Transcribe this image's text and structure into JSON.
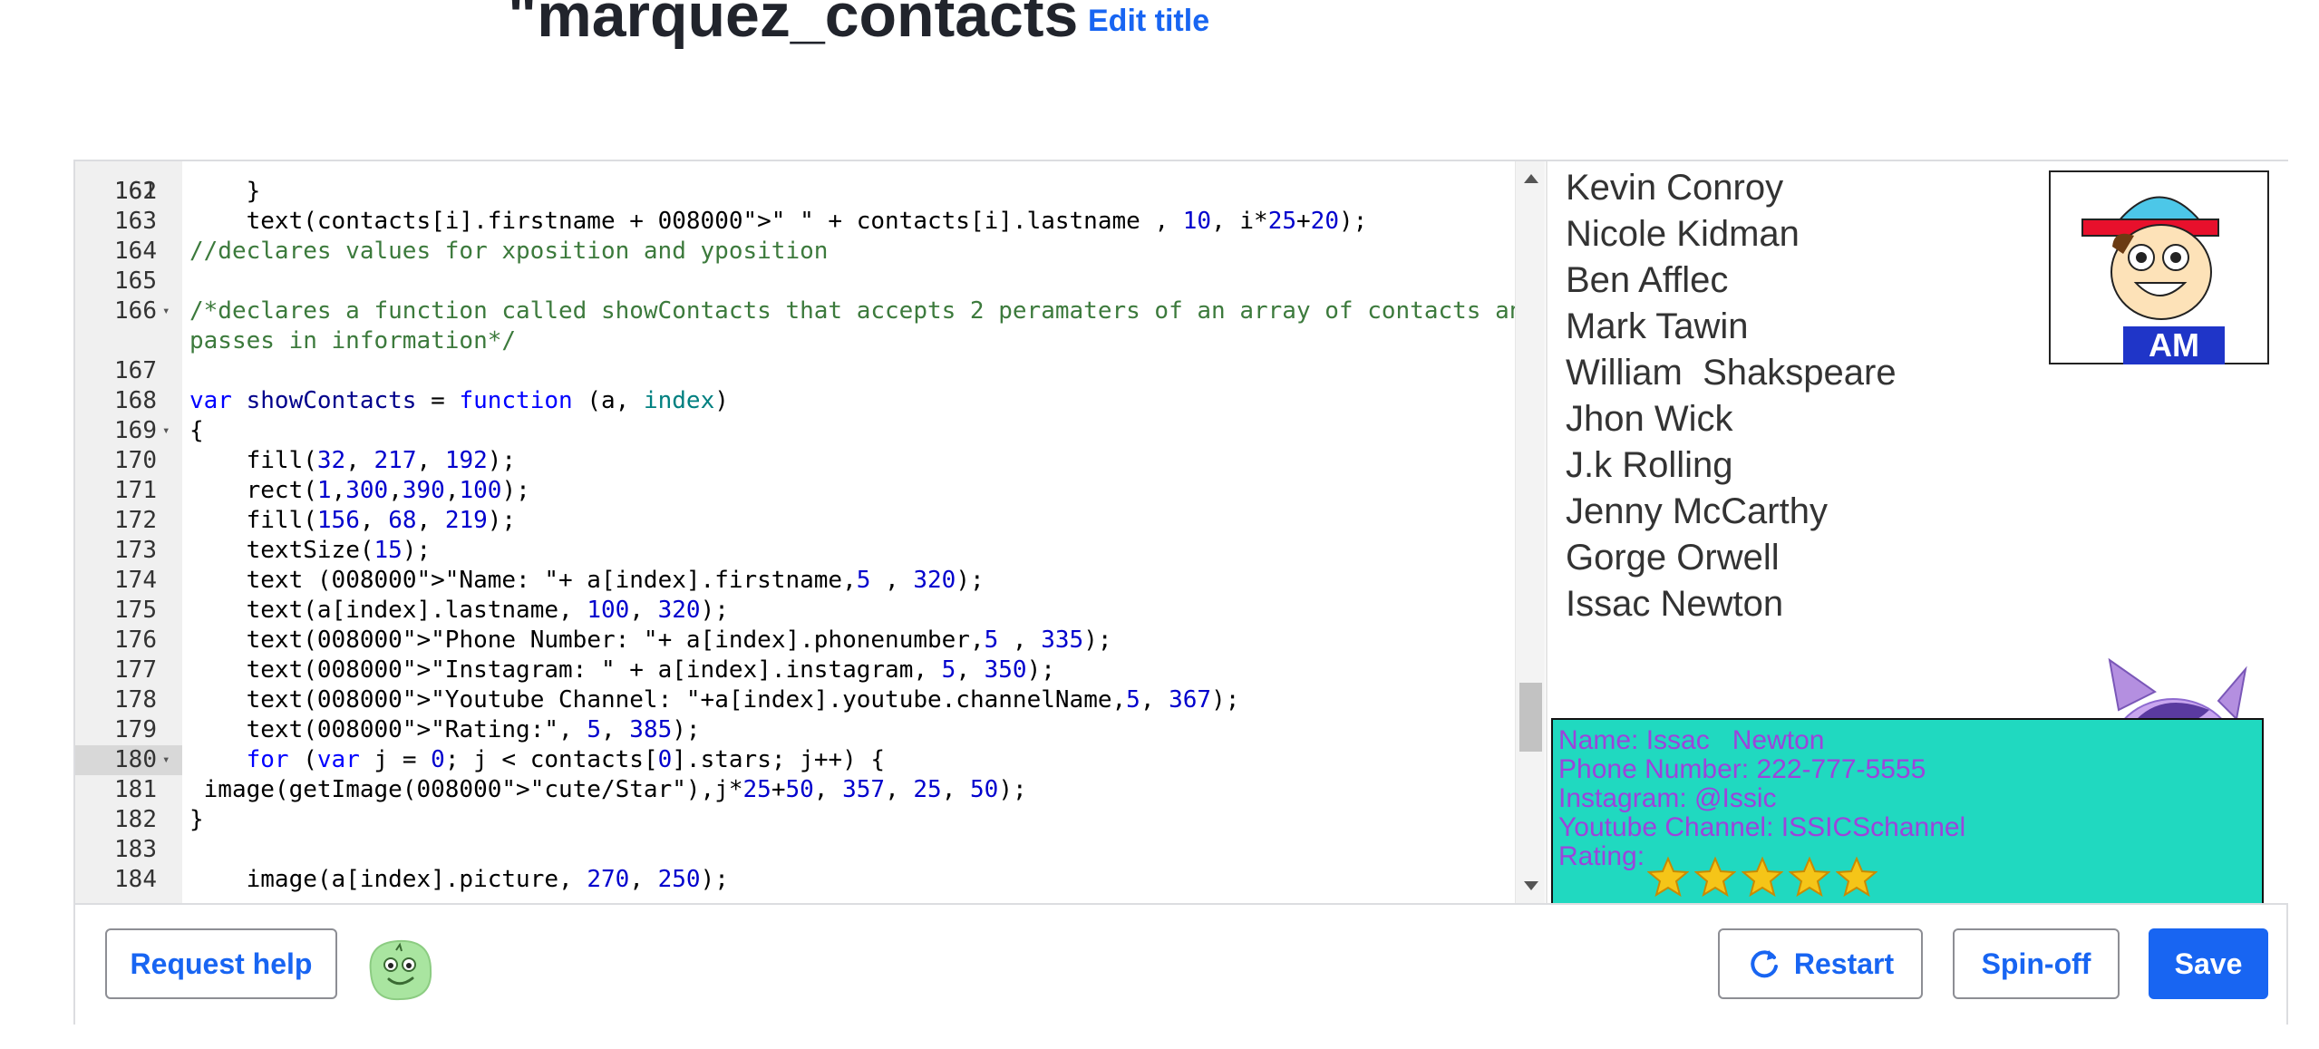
{
  "header": {
    "title": "\"marquez_contacts",
    "edit_title": "Edit title"
  },
  "editor": {
    "partial_top_line": "    text(contacts[i].firstname + \" \" + contacts[i].lastname , 10, i*25+20);",
    "lines": [
      {
        "n": "162",
        "text": "    }"
      },
      {
        "n": "163",
        "text": ""
      },
      {
        "n": "164",
        "text": "//declares values for xposition and yposition"
      },
      {
        "n": "165",
        "text": ""
      },
      {
        "n": "166",
        "text": "/*declares a function called showContacts that accepts 2 peramaters of an array of contacts and passes in information*/",
        "fold": true
      },
      {
        "n": "167",
        "text": ""
      },
      {
        "n": "168",
        "text": "var showContacts = function (a, index)"
      },
      {
        "n": "169",
        "text": "{",
        "fold": true
      },
      {
        "n": "170",
        "text": "    fill(32, 217, 192);"
      },
      {
        "n": "171",
        "text": "    rect(1,300,390,100);"
      },
      {
        "n": "172",
        "text": "    fill(156, 68, 219);"
      },
      {
        "n": "173",
        "text": "    textSize(15);"
      },
      {
        "n": "174",
        "text": "    text (\"Name: \"+ a[index].firstname,5 , 320);"
      },
      {
        "n": "175",
        "text": "    text(a[index].lastname, 100, 320);"
      },
      {
        "n": "176",
        "text": "    text(\"Phone Number: \"+ a[index].phonenumber,5 , 335);"
      },
      {
        "n": "177",
        "text": "    text(\"Instagram: \" + a[index].instagram, 5, 350);"
      },
      {
        "n": "178",
        "text": "    text(\"Youtube Channel: \"+a[index].youtube.channelName,5, 367);"
      },
      {
        "n": "179",
        "text": "    text(\"Rating:\", 5, 385);"
      },
      {
        "n": "180",
        "text": "    for (var j = 0; j < contacts[0].stars; j++) {",
        "fold": true,
        "active": true
      },
      {
        "n": "181",
        "text": " image(getImage(\"cute/Star\"),j*25+50, 357, 25, 50);"
      },
      {
        "n": "182",
        "text": "}"
      },
      {
        "n": "183",
        "text": ""
      },
      {
        "n": "184",
        "text": "    image(a[index].picture, 270, 250);"
      }
    ]
  },
  "canvas": {
    "contacts": [
      "Kevin Conroy",
      "Nicole Kidman",
      "Ben Afflec",
      "Mark Tawin",
      "William  Shakspeare",
      "Jhon Wick",
      "J.k Rolling",
      "Jenny McCarthy",
      "Gorge Orwell",
      "Issac Newton"
    ],
    "avatar_label": "AM",
    "info": {
      "name": "Name: Issac   Newton",
      "phone": "Phone Number: 222-777-5555",
      "instagram": "Instagram: @Issic",
      "youtube": "Youtube Channel: ISSICSchannel",
      "rating": "Rating:",
      "stars": 5
    },
    "colors": {
      "panel": "#20d9c0",
      "panel_text": "#9c44db",
      "star": "#f5c518"
    }
  },
  "footer": {
    "request_help": "Request help",
    "restart": "Restart",
    "spin_off": "Spin-off",
    "save": "Save"
  },
  "theme": {
    "accent": "#1865f2"
  }
}
